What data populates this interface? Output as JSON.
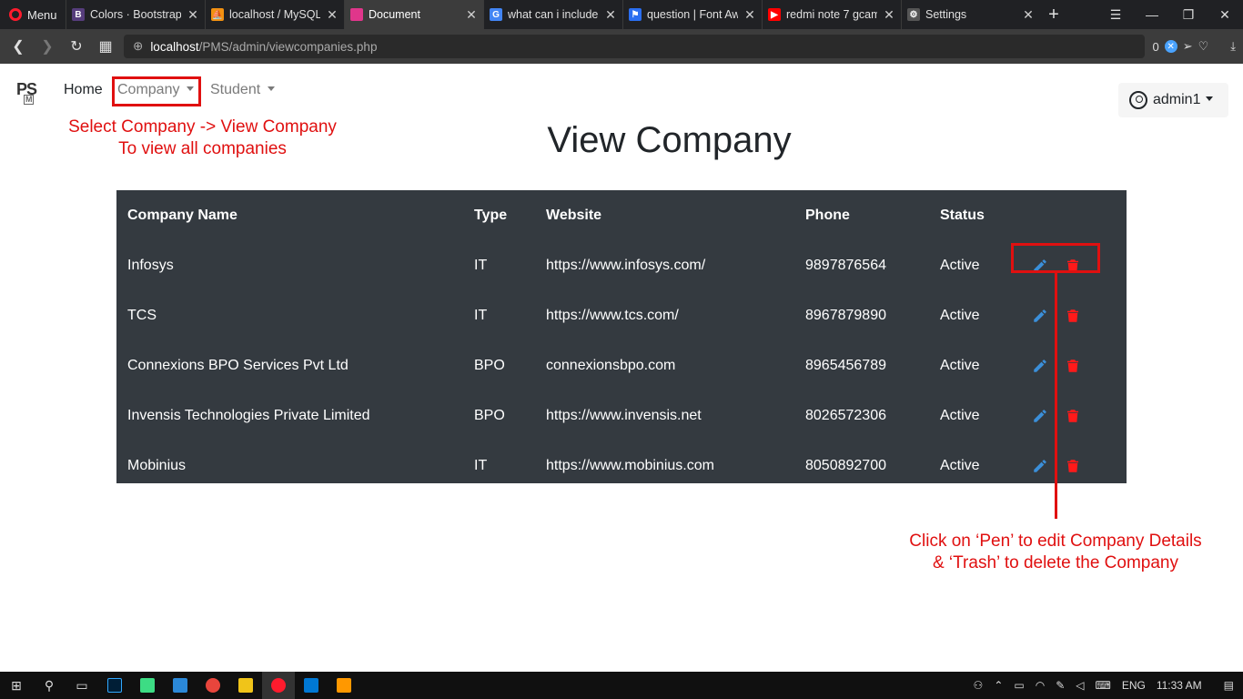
{
  "browser": {
    "menu_label": "Menu",
    "tabs": [
      {
        "title": "Colors · Bootstrap",
        "fav": "B",
        "color": "#563d7c"
      },
      {
        "title": "localhost / MySQL",
        "fav": "⛵",
        "color": "#f29111"
      },
      {
        "title": "Document",
        "fav": "",
        "color": "#e0368b"
      },
      {
        "title": "what can i include",
        "fav": "G",
        "color": "#4285f4"
      },
      {
        "title": "question | Font Aw",
        "fav": "⚑",
        "color": "#2a6ef0"
      },
      {
        "title": "redmi note 7 gcam",
        "fav": "▶",
        "color": "#ff0000"
      },
      {
        "title": "Settings",
        "fav": "⚙",
        "color": "#555555"
      }
    ],
    "url_host": "localhost",
    "url_path": "/PMS/admin/viewcompanies.php",
    "badge_count": "0"
  },
  "navbar": {
    "brand": "PS",
    "brand_sub": "M",
    "home": "Home",
    "company": "Company",
    "student": "Student",
    "user": "admin1"
  },
  "annotations": {
    "note1_line1": "Select Company -> View Company",
    "note1_line2": "To view all companies",
    "note2_line1": "Click on ‘Pen’ to edit Company Details",
    "note2_line2": "& ‘Trash’ to delete the Company"
  },
  "page": {
    "title": "View Company"
  },
  "table": {
    "headers": [
      "Company Name",
      "Type",
      "Website",
      "Phone",
      "Status"
    ],
    "rows": [
      [
        "Infosys",
        "IT",
        "https://www.infosys.com/",
        "9897876564",
        "Active"
      ],
      [
        "TCS",
        "IT",
        "https://www.tcs.com/",
        "8967879890",
        "Active"
      ],
      [
        "Connexions BPO Services Pvt Ltd",
        "BPO",
        "connexionsbpo.com",
        "8965456789",
        "Active"
      ],
      [
        "Invensis Technologies Private Limited",
        "BPO",
        "https://www.invensis.net",
        "8026572306",
        "Active"
      ],
      [
        "Mobinius",
        "IT",
        "https://www.mobinius.com",
        "8050892700",
        "Active"
      ]
    ]
  },
  "taskbar": {
    "lang": "ENG",
    "time": "11:33 AM"
  },
  "colors": {
    "table_bg": "#343a40",
    "pen": "#3b8fd9",
    "trash": "#ff1a1a",
    "annotation": "#e01010"
  }
}
